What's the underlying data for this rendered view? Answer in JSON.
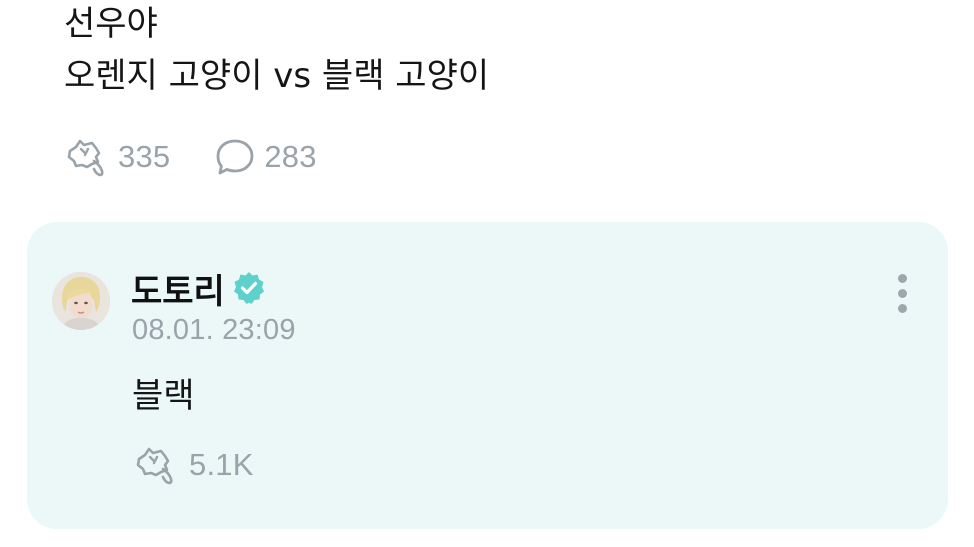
{
  "post": {
    "lines": [
      "선우야",
      "오렌지 고양이 vs 블랙 고양이"
    ],
    "stats": {
      "likes": "335",
      "comments": "283"
    }
  },
  "comment": {
    "author": "도토리",
    "verified": true,
    "timestamp": "08.01. 23:09",
    "text": "블랙",
    "likes": "5.1K"
  },
  "colors": {
    "card_background": "#ebf8f7",
    "muted_text": "#9aa3a9",
    "verified_badge": "#5ed1cc"
  },
  "icons": {
    "like": "like-icon",
    "comment": "comment-bubble-icon",
    "verified": "verified-badge-icon",
    "more": "more-vertical-icon"
  }
}
